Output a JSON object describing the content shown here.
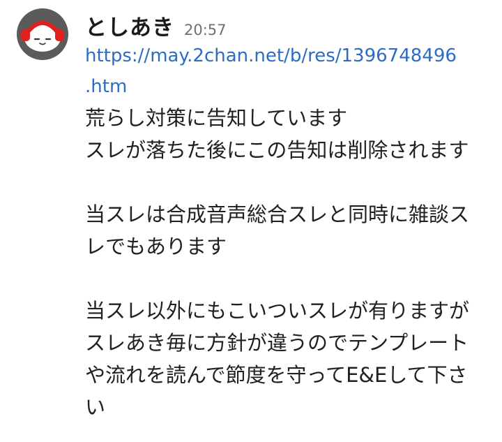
{
  "author": {
    "name": "としあき"
  },
  "timestamp": "20:57",
  "message": {
    "link_line1": "https://may.2chan.net/b/res/1396748496",
    "link_line2": ".htm",
    "paragraphs": [
      {
        "lines": [
          "荒らし対策に告知しています",
          "スレが落ちた後にこの告知は削除されます"
        ]
      },
      {
        "lines": [
          "当スレは合成音声総合スレと同時に雑談ス",
          "レでもあります"
        ]
      },
      {
        "lines": [
          "当スレ以外にもこいついスレが有りますが",
          "スレあき毎に方針が違うのでテンプレート",
          "や流れを読んで節度を守ってE&Eして下さ",
          "い"
        ]
      }
    ]
  },
  "colors": {
    "link": "#2a6cc7",
    "avatar_bg": "#5b5b5b",
    "headphones": "#e0201e"
  },
  "icons": {
    "avatar": "headphone-face-avatar-icon"
  }
}
